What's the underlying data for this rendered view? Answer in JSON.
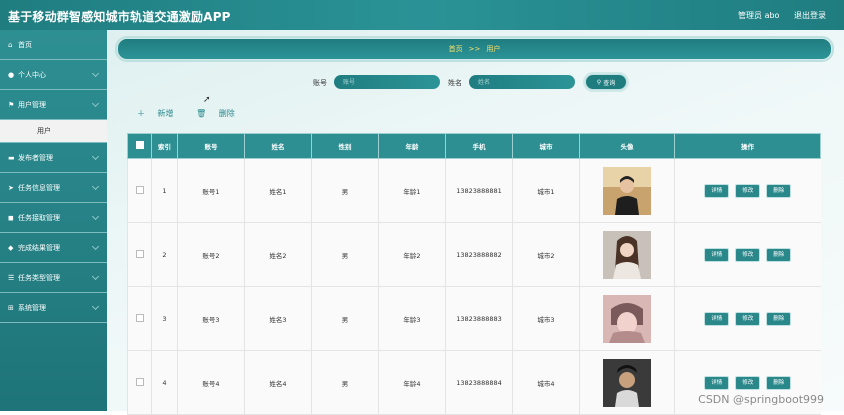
{
  "app": {
    "title": "基于移动群智感知城市轨道交通激励APP",
    "admin_label": "管理员 abo",
    "logout": "退出登录"
  },
  "sidebar": {
    "items": [
      {
        "icon": "home-icon",
        "glyph": "⌂",
        "label": "首页"
      },
      {
        "icon": "user-icon",
        "glyph": "●",
        "label": "个人中心"
      },
      {
        "icon": "flag-icon",
        "glyph": "⚑",
        "label": "用户管理"
      },
      {
        "icon": "monitor-icon",
        "glyph": "▬",
        "label": "发布者管理"
      },
      {
        "icon": "send-icon",
        "glyph": "➤",
        "label": "任务信息管理"
      },
      {
        "icon": "database-icon",
        "glyph": "◼",
        "label": "任务接取管理"
      },
      {
        "icon": "shield-icon",
        "glyph": "◆",
        "label": "完成结果管理"
      },
      {
        "icon": "sliders-icon",
        "glyph": "☰",
        "label": "任务类型管理"
      },
      {
        "icon": "grid-icon",
        "glyph": "⊞",
        "label": "系统管理"
      }
    ],
    "sub_item": "用户"
  },
  "breadcrumb": {
    "home": "首页",
    "sep": ">>",
    "current": "用户"
  },
  "search": {
    "account_label": "账号",
    "account_placeholder": "账号",
    "name_label": "姓名",
    "name_placeholder": "姓名",
    "button": "查询"
  },
  "actions": {
    "add": "新增",
    "delete": "删除"
  },
  "table": {
    "headers": [
      "",
      "索引",
      "账号",
      "姓名",
      "性别",
      "年龄",
      "手机",
      "城市",
      "头像",
      "操作"
    ],
    "rows": [
      {
        "index": "1",
        "account": "账号1",
        "name": "姓名1",
        "gender": "男",
        "age": "年龄1",
        "phone": "13823888881",
        "city": "城市1"
      },
      {
        "index": "2",
        "account": "账号2",
        "name": "姓名2",
        "gender": "男",
        "age": "年龄2",
        "phone": "13823888882",
        "city": "城市2"
      },
      {
        "index": "3",
        "account": "账号3",
        "name": "姓名3",
        "gender": "男",
        "age": "年龄3",
        "phone": "13823888883",
        "city": "城市3"
      },
      {
        "index": "4",
        "account": "账号4",
        "name": "姓名4",
        "gender": "男",
        "age": "年龄4",
        "phone": "13823888884",
        "city": "城市4"
      }
    ],
    "ops": {
      "detail": "详情",
      "edit": "修改",
      "delete": "删除"
    }
  },
  "watermark": "CSDN @springboot999",
  "colors": {
    "primary": "#2a8a8d",
    "breadcrumb_text": "#ffe36b",
    "header": "#1f7d80"
  }
}
